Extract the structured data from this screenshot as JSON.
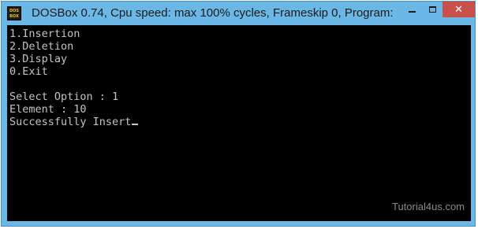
{
  "window": {
    "title": "DOSBox 0.74, Cpu speed: max 100% cycles, Frameskip  0, Program:",
    "icon": {
      "name": "dosbox-icon",
      "line1": "DOS",
      "line2": "BOX"
    },
    "controls": {
      "minimize": "minimize",
      "maximize": "maximize",
      "close": "✕"
    }
  },
  "console": {
    "lines": [
      "1.Insertion",
      "2.Deletion",
      "3.Display",
      "0.Exit",
      "",
      "Select Option : 1",
      "Element : 10",
      "Successfully Insert"
    ]
  },
  "watermark": "Tutorial4us.com",
  "colors": {
    "frame": "#6bb8e6",
    "close_button": "#c7504a",
    "console_bg": "#000000",
    "console_text": "#c4c4c4"
  }
}
